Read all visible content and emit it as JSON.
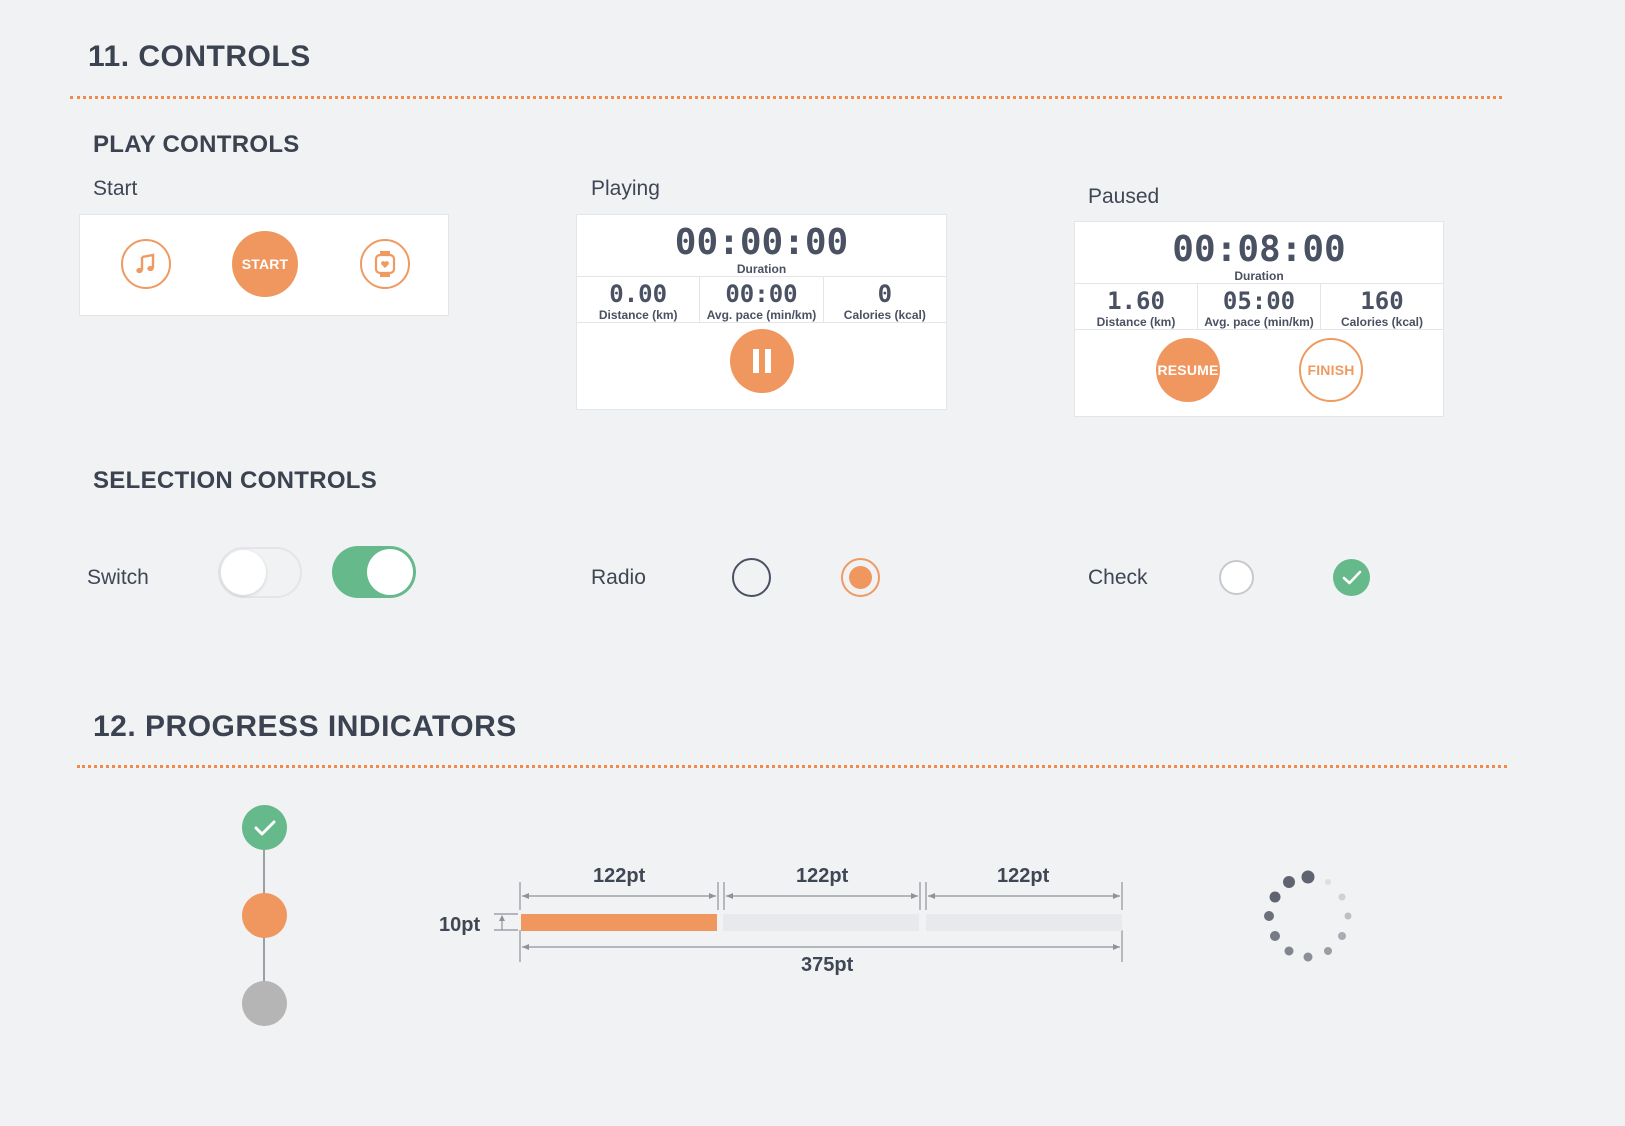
{
  "controls": {
    "title": "11. CONTROLS",
    "play": {
      "heading": "PLAY CONTROLS",
      "start": {
        "label": "Start",
        "start_button": "START",
        "music_icon": "music-note-icon",
        "watch_icon": "smartwatch-heart-icon"
      },
      "playing": {
        "label": "Playing",
        "duration_value": "00:00:00",
        "duration_label": "Duration",
        "stats": [
          {
            "value": "0.00",
            "label": "Distance (km)"
          },
          {
            "value": "00:00",
            "label": "Avg. pace  (min/km)"
          },
          {
            "value": "0",
            "label": "Calories (kcal)"
          }
        ],
        "pause_icon": "pause-icon"
      },
      "paused": {
        "label": "Paused",
        "duration_value": "00:08:00",
        "duration_label": "Duration",
        "stats": [
          {
            "value": "1.60",
            "label": "Distance (km)"
          },
          {
            "value": "05:00",
            "label": "Avg. pace  (min/km)"
          },
          {
            "value": "160",
            "label": "Calories (kcal)"
          }
        ],
        "resume_button": "RESUME",
        "finish_button": "FINISH"
      }
    },
    "selection": {
      "heading": "SELECTION CONTROLS",
      "switch_label": "Switch",
      "radio_label": "Radio",
      "check_label": "Check"
    }
  },
  "progress": {
    "title": "12. PROGRESS INDICATORS",
    "segment_label_1": "122pt",
    "segment_label_2": "122pt",
    "segment_label_3": "122pt",
    "height_label": "10pt",
    "total_label": "375pt",
    "progress_fraction": 0.333
  },
  "colors": {
    "accent": "#f0975f",
    "green": "#66b98a",
    "gray": "#b5b5b5",
    "text": "#3f4654"
  }
}
